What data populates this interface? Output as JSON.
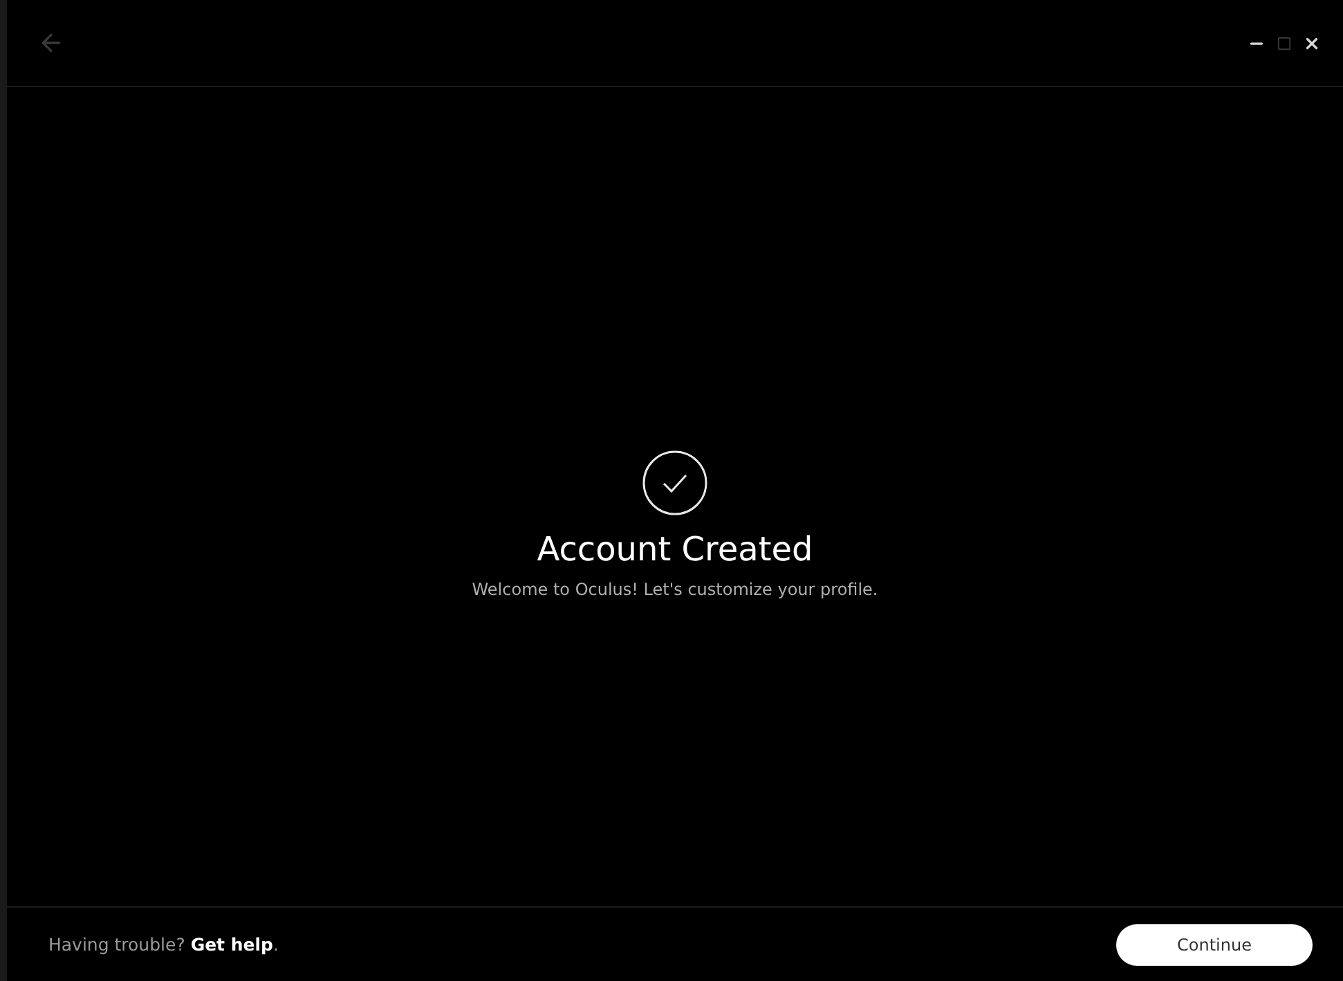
{
  "titlebar": {
    "back_disabled": true,
    "controls": [
      {
        "kind": "minimize",
        "disabled": false
      },
      {
        "kind": "maximize",
        "disabled": true
      },
      {
        "kind": "close",
        "disabled": false
      }
    ]
  },
  "main": {
    "title": "Account Created",
    "message": "Welcome to Oculus! Let's customize your profile."
  },
  "footer": {
    "help_prefix": "Having trouble?",
    "help_link": "Get help",
    "help_suffix": ".",
    "button": "Continue"
  }
}
